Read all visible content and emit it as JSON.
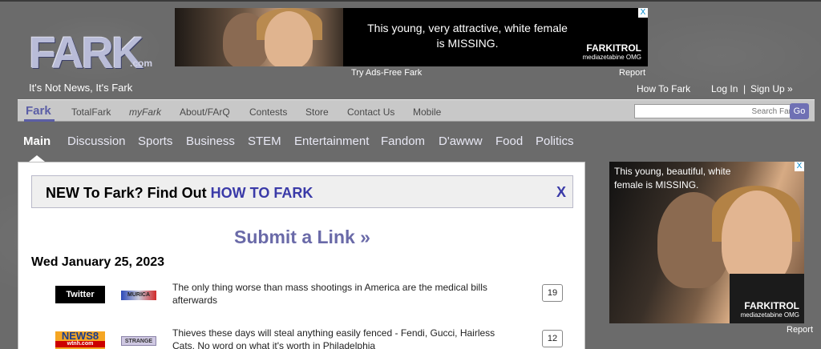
{
  "header": {
    "logo": "FARK",
    "logo_suffix": ".com",
    "tagline": "It's Not News, It's Fark",
    "ads_free": "Try Ads-Free Fark",
    "report": "Report",
    "how_to": "How To Fark",
    "login": "Log In",
    "sep": "|",
    "signup": "Sign Up »"
  },
  "top_ad": {
    "text": "This young, very attractive, white female is MISSING.",
    "brand": "FARKITROL",
    "brand_sub": "mediazetabine OMG",
    "close": "X"
  },
  "navbar": {
    "active": "Fark",
    "items": [
      "TotalFark",
      "myFark",
      "About/FArQ",
      "Contests",
      "Store",
      "Contact Us",
      "Mobile"
    ],
    "search_placeholder": "Search Fark",
    "go": "Go"
  },
  "categories": [
    "Main",
    "Discussion",
    "Sports",
    "Business",
    "STEM",
    "Entertainment",
    "Fandom",
    "D'awww",
    "Food",
    "Politics"
  ],
  "main": {
    "new_text": "NEW To Fark? Find Out ",
    "new_link": "HOW TO FARK",
    "close": "X",
    "submit": "Submit a Link »",
    "date": "Wed January 25, 2023",
    "links": [
      {
        "source": "Twitter",
        "tag": "MURICA",
        "headline": "The only thing worse than mass shootings in America are the medical bills afterwards",
        "comments": "19"
      },
      {
        "source": "NEWS8",
        "source_sub": "wtnh.com",
        "tag": "STRANGE",
        "headline": "Thieves these days will steal anything easily fenced - Fendi, Gucci, Hairless Cats. No word on what it's worth in Philadelphia",
        "comments": "12"
      }
    ]
  },
  "right_ad": {
    "text": "This young, beautiful, white female is MISSING.",
    "brand": "FARKITROL",
    "brand_sub": "mediazetabine OMG",
    "close": "X",
    "report": "Report"
  }
}
